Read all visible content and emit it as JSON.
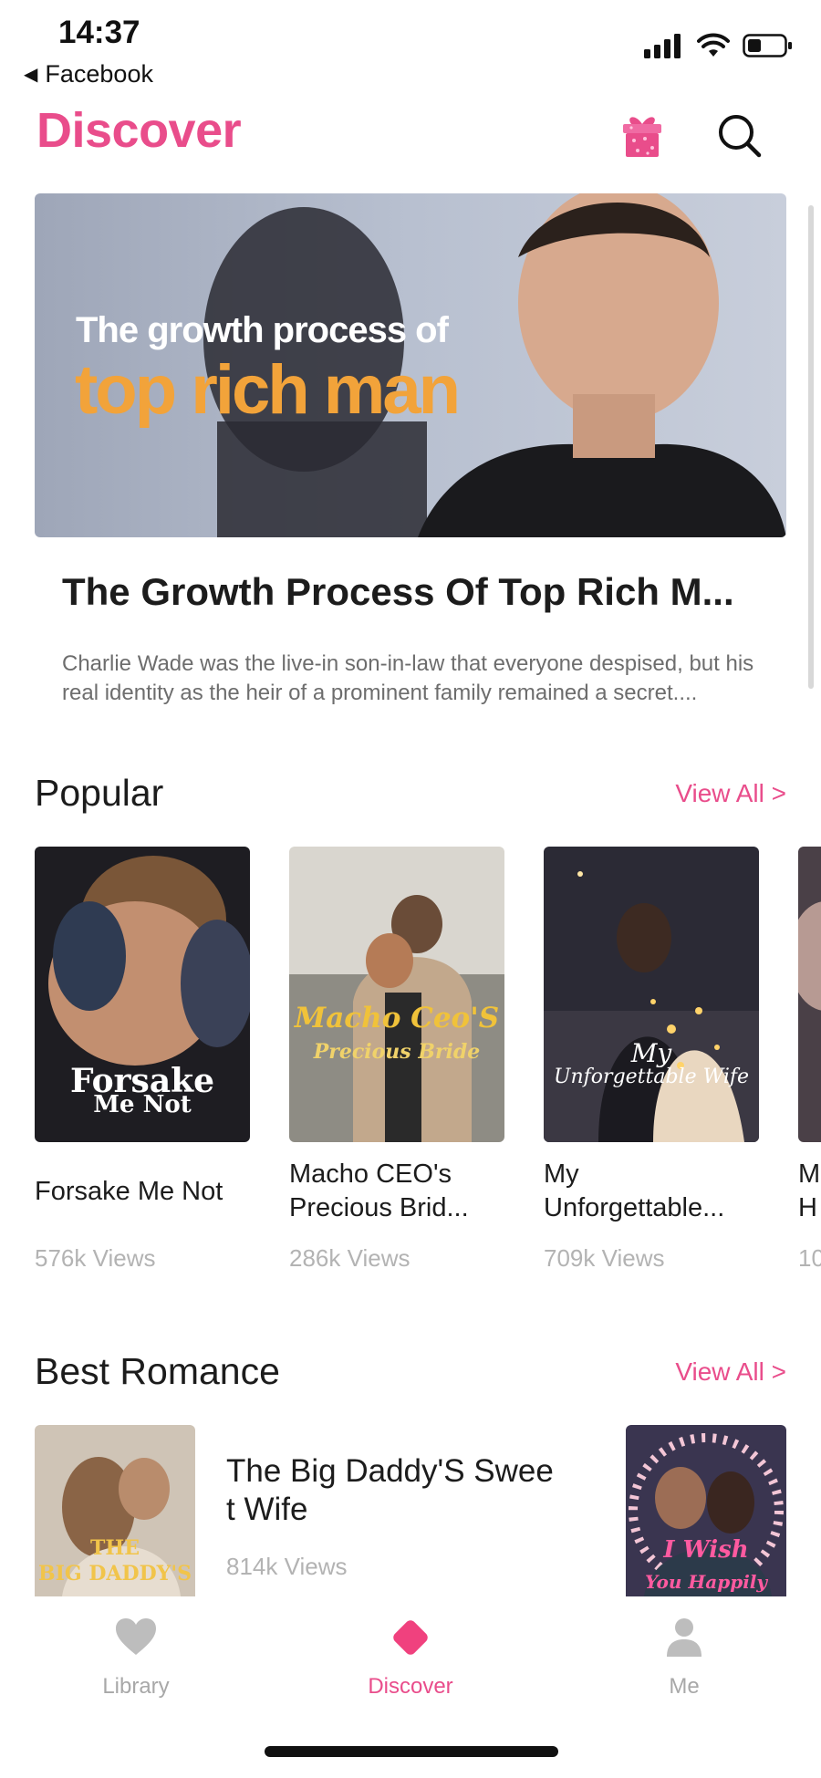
{
  "status_bar": {
    "time": "14:37",
    "back_app": "Facebook"
  },
  "header": {
    "title": "Discover"
  },
  "featured": {
    "banner_line1": "The growth process of",
    "banner_line2": "top rich man",
    "title": "The Growth Process Of  Top Rich M...",
    "description": "Charlie Wade was the live-in son-in-law that everyone despised, but his real identity as the heir of a prominent family remained a secret...."
  },
  "popular": {
    "title": "Popular",
    "view_all": "View All  >",
    "books": [
      {
        "title": "Forsake Me Not",
        "views": "576k Views",
        "cover_text": "Forsake",
        "cover_text2": "Me Not"
      },
      {
        "title": "Macho CEO's Precious Brid...",
        "views": "286k Views",
        "cover_text": "Macho Ceo'S",
        "cover_text2": "Precious Bride"
      },
      {
        "title": "My Unforgettable...",
        "views": "709k Views",
        "cover_text": "My",
        "cover_text2": "Unforgettable Wife"
      },
      {
        "title": "M H",
        "views": "10"
      }
    ]
  },
  "best_romance": {
    "title": "Best Romance",
    "view_all": "View All  >",
    "book": {
      "title": "The Big Daddy'S Swee t Wife",
      "views": "814k Views",
      "cover_text": "THE",
      "cover_text2": "BIG DADDY'S"
    },
    "second_cover_text": "I Wish",
    "second_cover_text2": "You Happily"
  },
  "tabbar": {
    "tabs": [
      {
        "label": "Library",
        "icon": "heart-icon"
      },
      {
        "label": "Discover",
        "icon": "diamond-icon"
      },
      {
        "label": "Me",
        "icon": "person-icon"
      }
    ]
  },
  "colors": {
    "accent": "#e94d8b",
    "muted": "#b3b3b3",
    "banner_orange": "#f2a33a"
  }
}
